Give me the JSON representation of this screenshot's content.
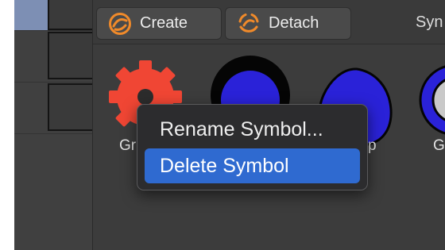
{
  "toolbar": {
    "create_label": "Create",
    "detach_label": "Detach",
    "panel_title": "Syn"
  },
  "symbols": {
    "gear_label": "Gr",
    "blob_label": "p",
    "ring_label": "G"
  },
  "context_menu": {
    "items": [
      {
        "label": "Rename Symbol...",
        "highlighted": false
      },
      {
        "label": "Delete Symbol",
        "highlighted": true
      }
    ]
  },
  "colors": {
    "accent_orange": "#f08a2a",
    "gear_red": "#f04634",
    "symbol_blue": "#2a22d8",
    "menu_highlight": "#2f6ad0"
  }
}
